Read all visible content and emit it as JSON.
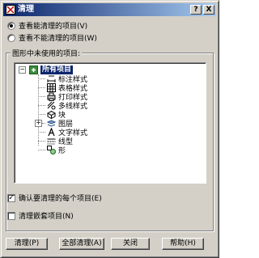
{
  "window": {
    "title": "清理",
    "help_btn": "?",
    "close_btn": "X"
  },
  "options": {
    "view_purgeable": "查看能清理的项目(V)",
    "view_unpurgeable": "查看不能清理的项目(W)",
    "selected": "view_purgeable"
  },
  "group": {
    "title": "图形中未使用的项目:"
  },
  "tree": {
    "root_label": "所有项目",
    "items": [
      {
        "label": "标注样式",
        "icon": "dimension-style-icon"
      },
      {
        "label": "表格样式",
        "icon": "table-style-icon"
      },
      {
        "label": "打印样式",
        "icon": "plot-style-icon"
      },
      {
        "label": "多线样式",
        "icon": "multiline-style-icon"
      },
      {
        "label": "块",
        "icon": "block-icon"
      },
      {
        "label": "图层",
        "icon": "layer-icon",
        "expandable": true
      },
      {
        "label": "文字样式",
        "icon": "text-style-icon"
      },
      {
        "label": "线型",
        "icon": "linetype-icon"
      },
      {
        "label": "形",
        "icon": "shape-icon"
      }
    ]
  },
  "checkboxes": {
    "confirm_each": "确认要清理的每个项目(E)",
    "confirm_each_checked": true,
    "purge_nested": "清理嵌套项目(N)",
    "purge_nested_checked": false
  },
  "buttons": {
    "purge": "清理(P)",
    "purge_all": "全部清理(A)",
    "close": "关闭",
    "help": "帮助(H)"
  }
}
